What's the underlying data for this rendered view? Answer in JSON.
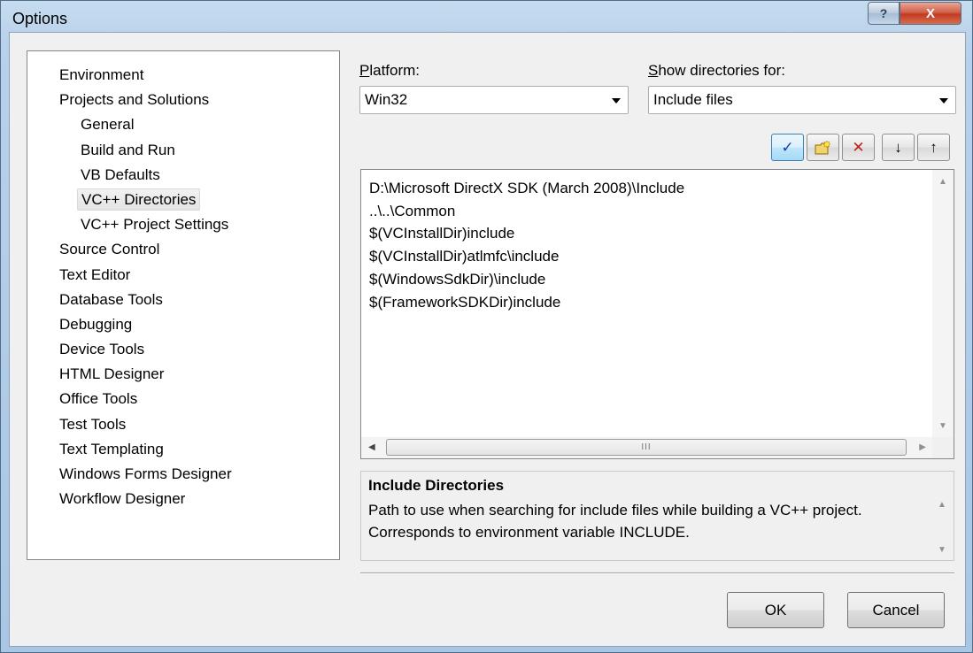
{
  "window": {
    "title": "Options",
    "help_glyph": "?",
    "close_glyph": "X"
  },
  "tree": {
    "items": [
      {
        "label": "Environment",
        "child": false
      },
      {
        "label": "Projects and Solutions",
        "child": false
      },
      {
        "label": "General",
        "child": true
      },
      {
        "label": "Build and Run",
        "child": true
      },
      {
        "label": "VB Defaults",
        "child": true
      },
      {
        "label": "VC++ Directories",
        "child": true,
        "selected": true
      },
      {
        "label": "VC++ Project Settings",
        "child": true
      },
      {
        "label": "Source Control",
        "child": false
      },
      {
        "label": "Text Editor",
        "child": false
      },
      {
        "label": "Database Tools",
        "child": false
      },
      {
        "label": "Debugging",
        "child": false
      },
      {
        "label": "Device Tools",
        "child": false
      },
      {
        "label": "HTML Designer",
        "child": false
      },
      {
        "label": "Office Tools",
        "child": false
      },
      {
        "label": "Test Tools",
        "child": false
      },
      {
        "label": "Text Templating",
        "child": false
      },
      {
        "label": "Windows Forms Designer",
        "child": false
      },
      {
        "label": "Workflow Designer",
        "child": false
      }
    ]
  },
  "platform": {
    "label_first": "P",
    "label_rest": "latform:",
    "value": "Win32"
  },
  "show_dirs": {
    "label_first": "S",
    "label_rest": "how directories for:",
    "value": "Include files"
  },
  "toolbar": {
    "check_glyph": "✓",
    "delete_glyph": "✕",
    "down_glyph": "↓",
    "up_glyph": "↑"
  },
  "directories": [
    "D:\\Microsoft DirectX SDK (March 2008)\\Include",
    "..\\..\\Common",
    "$(VCInstallDir)include",
    "$(VCInstallDir)atlmfc\\include",
    "$(WindowsSdkDir)\\include",
    "$(FrameworkSDKDir)include"
  ],
  "scroll": {
    "thumb_grip": "III"
  },
  "description": {
    "title": "Include Directories",
    "text": "Path to use when searching for include files while building a VC++ project.  Corresponds to environment variable INCLUDE."
  },
  "buttons": {
    "ok": "OK",
    "cancel": "Cancel"
  },
  "colors": {
    "close_red": "#c13a22",
    "selected_check": "#1a3d9e",
    "delete_red": "#c0201c"
  }
}
